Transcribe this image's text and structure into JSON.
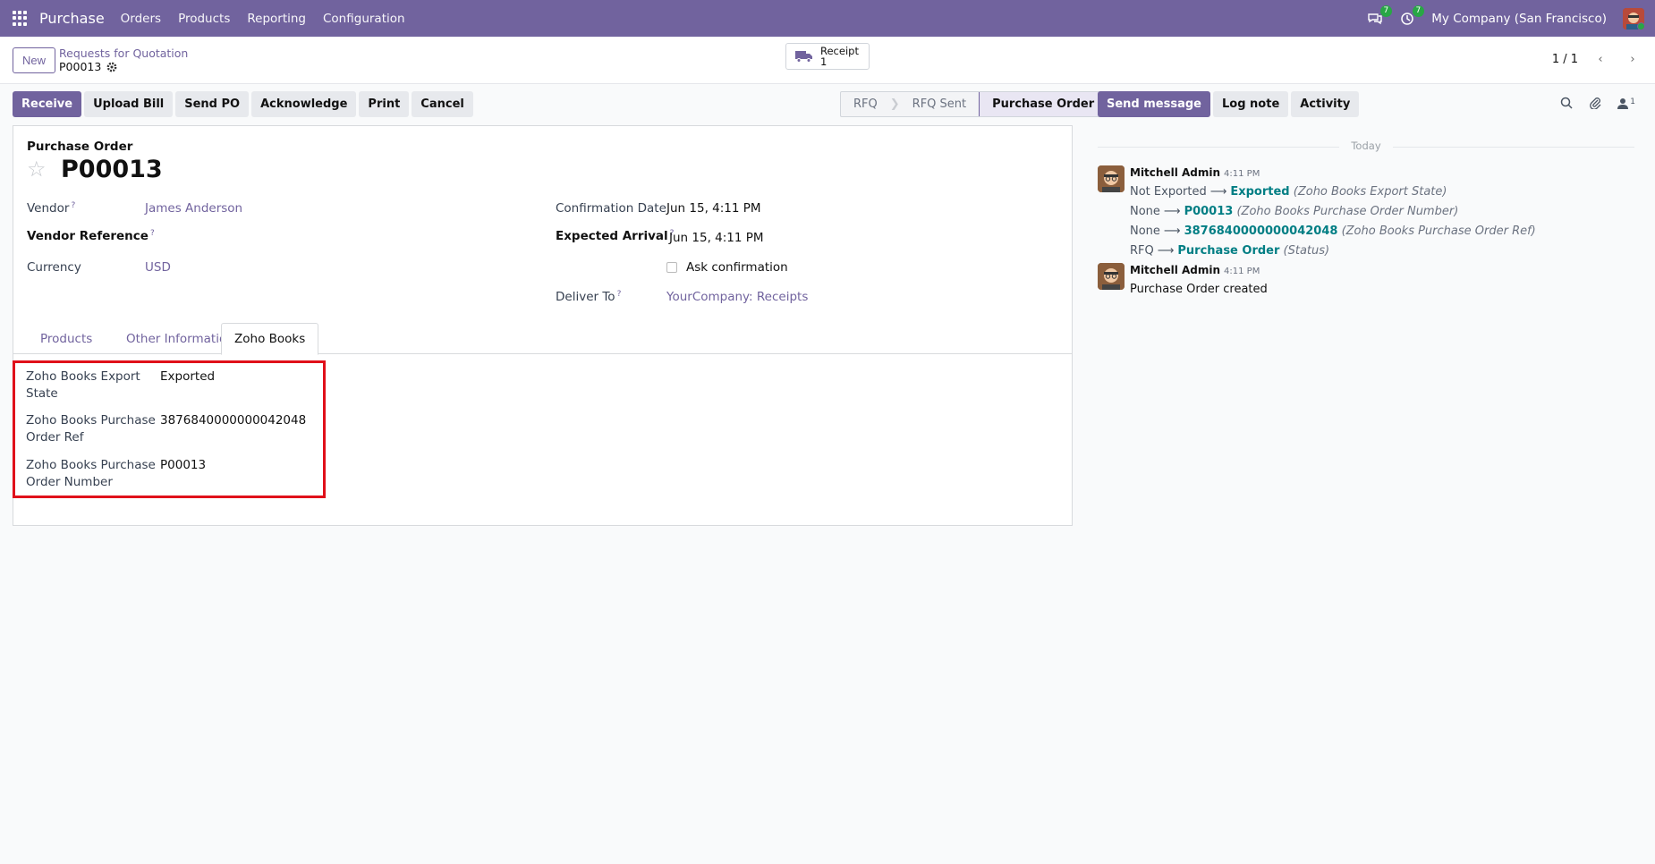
{
  "navbar": {
    "app_name": "Purchase",
    "menus": [
      "Orders",
      "Products",
      "Reporting",
      "Configuration"
    ],
    "messages_count": "7",
    "activities_count": "7",
    "company": "My Company (San Francisco)"
  },
  "control_panel": {
    "new_label": "New",
    "breadcrumb_parent": "Requests for Quotation",
    "breadcrumb_current": "P00013",
    "receipt_label": "Receipt",
    "receipt_count": "1",
    "pager": "1 / 1"
  },
  "actions": [
    "Receive",
    "Upload Bill",
    "Send PO",
    "Acknowledge",
    "Print",
    "Cancel"
  ],
  "status_stages": [
    "RFQ",
    "RFQ Sent",
    "Purchase Order"
  ],
  "status_active": "Purchase Order",
  "form": {
    "type_label": "Purchase Order",
    "name": "P00013",
    "vendor_label": "Vendor",
    "vendor_value": "James Anderson",
    "vendor_ref_label": "Vendor Reference",
    "currency_label": "Currency",
    "currency_value": "USD",
    "confirmation_date_label": "Confirmation Date",
    "confirmation_date_value": "Jun 15, 4:11 PM",
    "expected_arrival_label": "Expected Arrival",
    "expected_arrival_value": "Jun 15, 4:11 PM",
    "ask_confirmation_label": "Ask confirmation",
    "deliver_to_label": "Deliver To",
    "deliver_to_value": "YourCompany: Receipts",
    "help_mark": "?"
  },
  "tabs": [
    "Products",
    "Other Information",
    "Zoho Books"
  ],
  "zoho": {
    "export_state_label_1": "Zoho Books Export",
    "export_state_label_2": "State",
    "export_state_value": "Exported",
    "po_ref_label_1": "Zoho Books Purchase",
    "po_ref_label_2": "Order Ref",
    "po_ref_value": "3876840000000042048",
    "po_number_label_1": "Zoho Books Purchase",
    "po_number_label_2": "Order Number",
    "po_number_value": "P00013"
  },
  "chatter": {
    "send_message": "Send message",
    "log_note": "Log note",
    "activity": "Activity",
    "followers_count": "1",
    "today": "Today",
    "messages": [
      {
        "author": "Mitchell Admin",
        "time": "4:11 PM",
        "tracking": [
          {
            "old": "Not Exported",
            "new": "Exported",
            "field": "(Zoho Books Export State)"
          },
          {
            "old": "None",
            "new": "P00013",
            "field": "(Zoho Books Purchase Order Number)"
          },
          {
            "old": "None",
            "new": "3876840000000042048",
            "field": "(Zoho Books Purchase Order Ref)"
          },
          {
            "old": "RFQ",
            "new": "Purchase Order",
            "field": "(Status)"
          }
        ]
      },
      {
        "author": "Mitchell Admin",
        "time": "4:11 PM",
        "body": "Purchase Order created"
      }
    ]
  }
}
